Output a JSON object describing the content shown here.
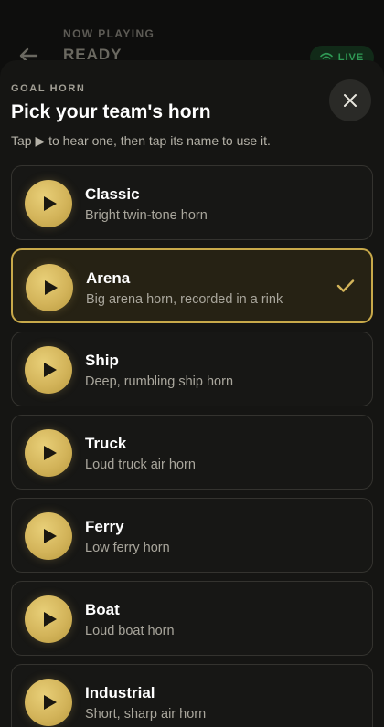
{
  "background": {
    "now_playing_label": "NOW PLAYING",
    "now_playing_title": "READY",
    "live_label": "LIVE"
  },
  "sheet": {
    "eyebrow": "GOAL HORN",
    "title": "Pick your team's horn",
    "hint": "Tap ▶ to hear one, then tap its name to use it.",
    "close_icon": "close-icon"
  },
  "horns": [
    {
      "name": "Classic",
      "desc": "Bright twin-tone horn",
      "selected": false
    },
    {
      "name": "Arena",
      "desc": "Big arena horn, recorded in a rink",
      "selected": true
    },
    {
      "name": "Ship",
      "desc": "Deep, rumbling ship horn",
      "selected": false
    },
    {
      "name": "Truck",
      "desc": "Loud truck air horn",
      "selected": false
    },
    {
      "name": "Ferry",
      "desc": "Low ferry horn",
      "selected": false
    },
    {
      "name": "Boat",
      "desc": "Loud boat horn",
      "selected": false
    },
    {
      "name": "Industrial",
      "desc": "Short, sharp air horn",
      "selected": false
    }
  ],
  "colors": {
    "accent_gold": "#d3b45a",
    "live_green": "#2f9a55",
    "sheet_bg": "#151513"
  }
}
